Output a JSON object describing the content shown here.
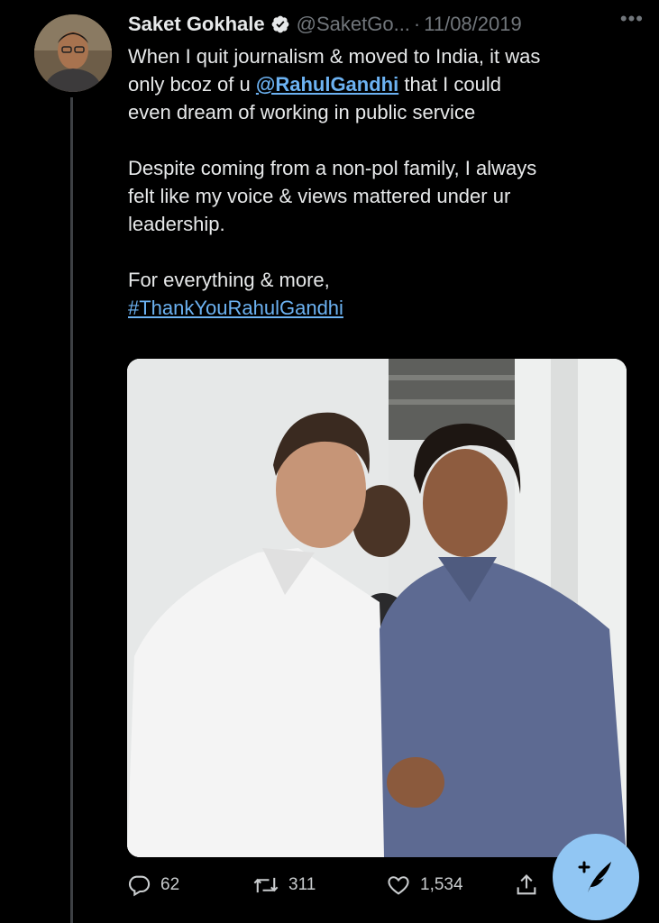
{
  "tweet": {
    "author_name": "Saket Gokhale",
    "handle": "@SaketGo...",
    "separator": "·",
    "date": "11/08/2019",
    "more_label": "•••",
    "text": {
      "p1_line1": "When I quit journalism & moved to India, it was",
      "p1_line2_pre": "only bcoz of u ",
      "mention": "@RahulGandhi",
      "p1_line2_post": " that I could",
      "p1_line3": "even dream of working in public service",
      "p2_line1": "Despite coming from a non-pol family, I always",
      "p2_line2": "felt like my voice & views mattered under ur",
      "p2_line3": "leadership.",
      "p3_line1": "For everything & more,",
      "hashtag": "#ThankYouRahulGandhi"
    },
    "stats": {
      "replies": "62",
      "retweets": "311",
      "likes": "1,534"
    }
  },
  "icons": {
    "verified": "verified-badge-icon",
    "reply": "reply-icon",
    "retweet": "retweet-icon",
    "like": "heart-icon",
    "share": "share-icon",
    "compose": "compose-tweet-icon"
  },
  "colors": {
    "background": "#000000",
    "text": "#e7e9ea",
    "muted": "#71767b",
    "link": "#6cb2f2",
    "compose_button": "#91c6f3"
  }
}
